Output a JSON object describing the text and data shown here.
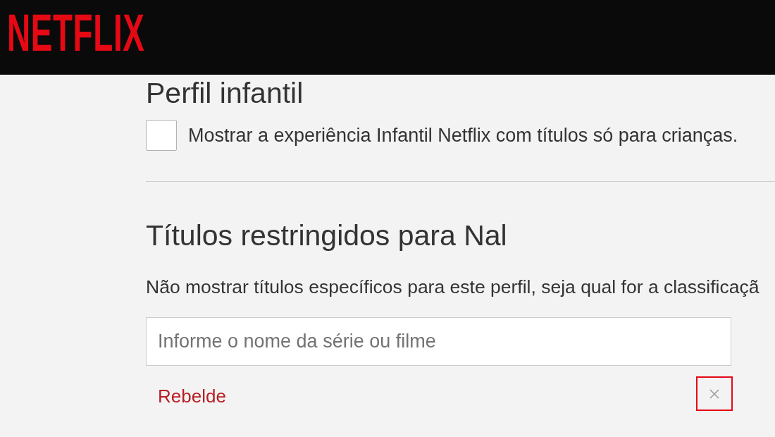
{
  "header": {
    "logo": "NETFLIX"
  },
  "kids_profile": {
    "heading": "Perfil infantil",
    "checkbox": {
      "label": "Mostrar a experiência Infantil Netflix com títulos só para crianças.",
      "checked": false
    }
  },
  "restrictions": {
    "heading": "Títulos restringidos para Nal",
    "description": "Não mostrar títulos específicos para este perfil, seja qual for a classificaçã",
    "search": {
      "placeholder": "Informe o nome da série ou filme"
    },
    "titles": [
      {
        "name": "Rebelde",
        "remove": {
          "focused": true
        }
      }
    ]
  }
}
